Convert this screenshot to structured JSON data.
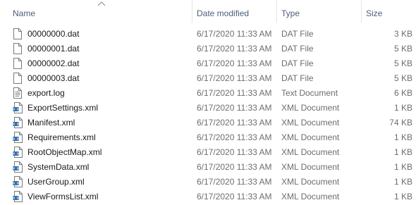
{
  "columns": {
    "name": "Name",
    "date_modified": "Date modified",
    "type": "Type",
    "size": "Size"
  },
  "sort": {
    "column": "name",
    "direction": "ascending",
    "icon": "chevron-up-icon"
  },
  "files": [
    {
      "name": "00000000.dat",
      "date": "6/17/2020 11:33 AM",
      "type": "DAT File",
      "size": "3 KB",
      "icon": "generic-file-icon"
    },
    {
      "name": "00000001.dat",
      "date": "6/17/2020 11:33 AM",
      "type": "DAT File",
      "size": "5 KB",
      "icon": "generic-file-icon"
    },
    {
      "name": "00000002.dat",
      "date": "6/17/2020 11:33 AM",
      "type": "DAT File",
      "size": "5 KB",
      "icon": "generic-file-icon"
    },
    {
      "name": "00000003.dat",
      "date": "6/17/2020 11:33 AM",
      "type": "DAT File",
      "size": "5 KB",
      "icon": "generic-file-icon"
    },
    {
      "name": "export.log",
      "date": "6/17/2020 11:33 AM",
      "type": "Text Document",
      "size": "6 KB",
      "icon": "text-document-icon"
    },
    {
      "name": "ExportSettings.xml",
      "date": "6/17/2020 11:33 AM",
      "type": "XML Document",
      "size": "1 KB",
      "icon": "xml-document-icon"
    },
    {
      "name": "Manifest.xml",
      "date": "6/17/2020 11:33 AM",
      "type": "XML Document",
      "size": "74 KB",
      "icon": "xml-document-icon"
    },
    {
      "name": "Requirements.xml",
      "date": "6/17/2020 11:33 AM",
      "type": "XML Document",
      "size": "1 KB",
      "icon": "xml-document-icon"
    },
    {
      "name": "RootObjectMap.xml",
      "date": "6/17/2020 11:33 AM",
      "type": "XML Document",
      "size": "1 KB",
      "icon": "xml-document-icon"
    },
    {
      "name": "SystemData.xml",
      "date": "6/17/2020 11:33 AM",
      "type": "XML Document",
      "size": "1 KB",
      "icon": "xml-document-icon"
    },
    {
      "name": "UserGroup.xml",
      "date": "6/17/2020 11:33 AM",
      "type": "XML Document",
      "size": "1 KB",
      "icon": "xml-document-icon"
    },
    {
      "name": "ViewFormsList.xml",
      "date": "6/17/2020 11:33 AM",
      "type": "XML Document",
      "size": "1 KB",
      "icon": "xml-document-icon"
    }
  ],
  "colors": {
    "header_text": "#4c607a",
    "secondary_text": "#6d6d6d",
    "xml_icon_accent": "#2f6fb3"
  }
}
